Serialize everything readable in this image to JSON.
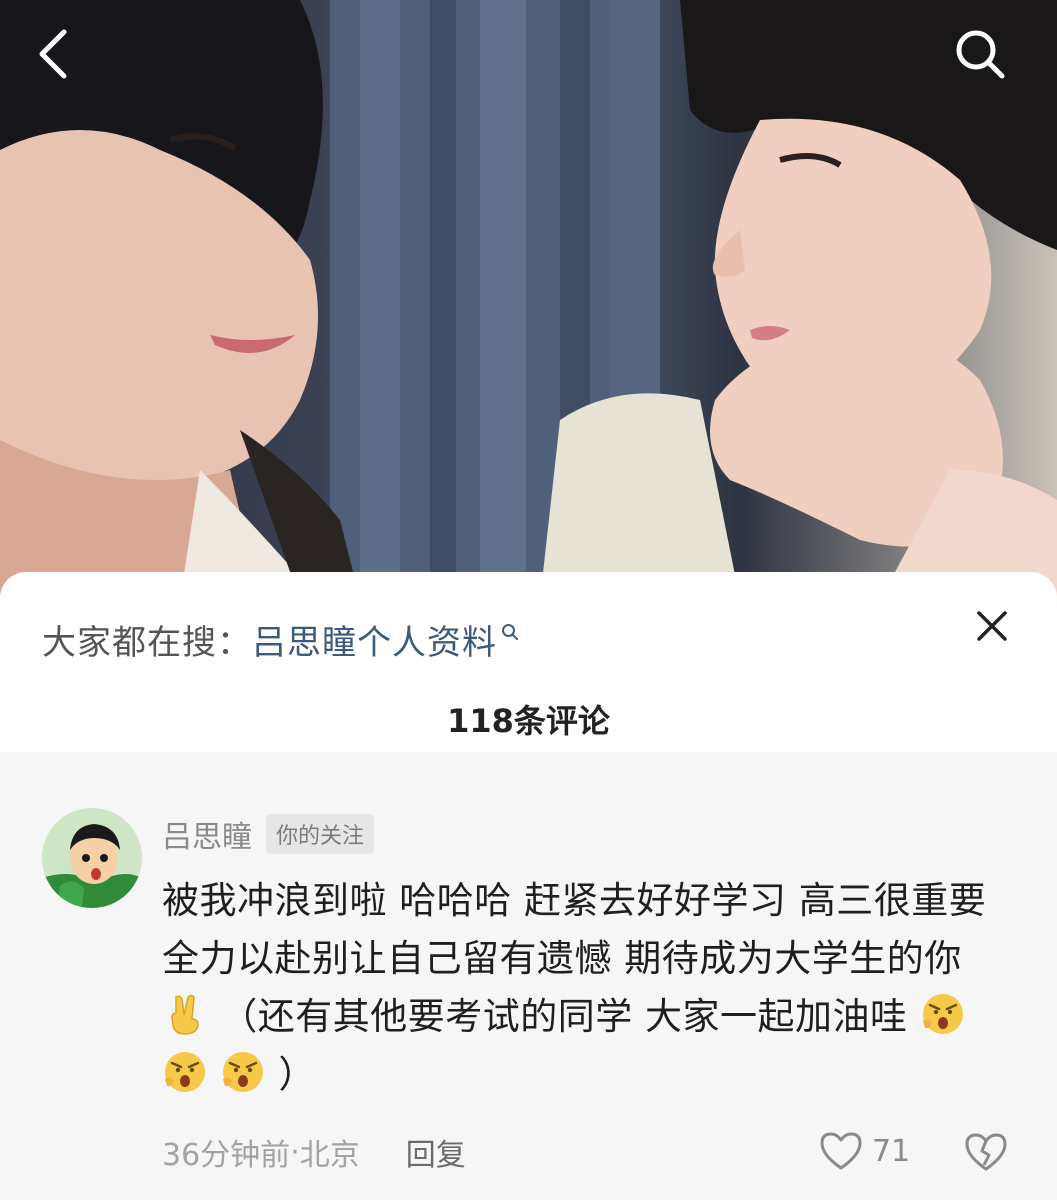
{
  "video": {
    "back_icon": "chevron-left-icon",
    "search_icon": "search-icon"
  },
  "hot_search": {
    "prefix": "大家都在搜：",
    "term": "吕思瞳个人资料",
    "term_color": "#3d5a7a",
    "close_icon": "close-icon"
  },
  "comments_header": {
    "count_label": "118条评论"
  },
  "comment": {
    "author": "吕思瞳",
    "badge": "你的关注",
    "text_before_emoji": "被我冲浪到啦 哈哈哈 赶紧去好好学习 高三很重要 全力以赴别让自己留有遗憾 期待成为大学生的你",
    "text_after_emoji": "（还有其他要考试的同学 大家一起加油哇",
    "text_end": "）",
    "emoji_victory": "victory-hand-emoji",
    "emoji_cheer": "shouting-face-emoji",
    "time": "36分钟前",
    "location_separator": " · ",
    "location": "北京",
    "reply_label": "回复",
    "like_count": "71",
    "like_icon": "heart-outline-icon",
    "dislike_icon": "broken-heart-icon"
  }
}
